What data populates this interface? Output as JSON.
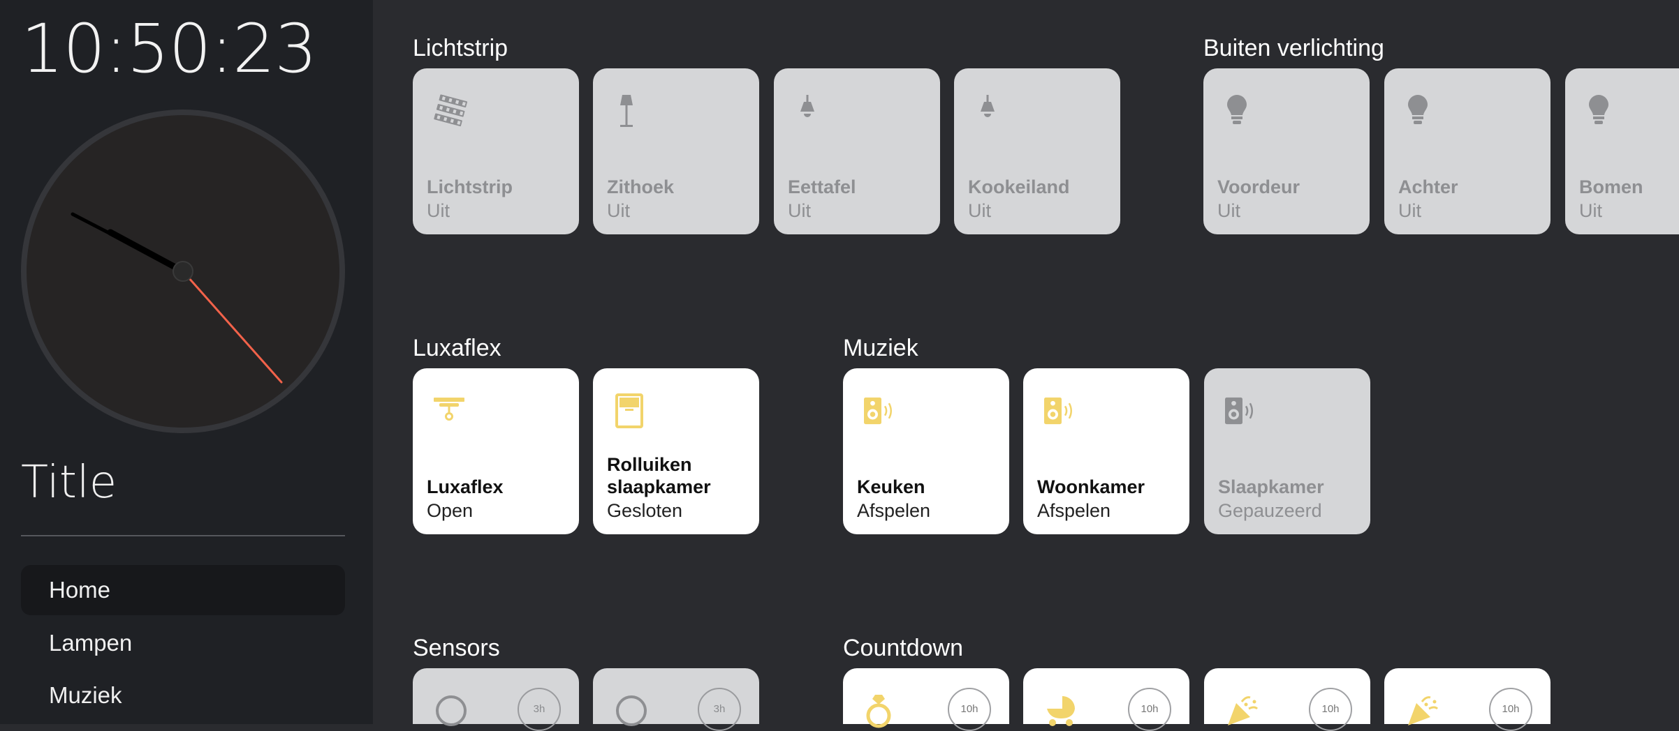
{
  "sidebar": {
    "clock": "10:50:23",
    "title": "Title",
    "nav": [
      {
        "label": "Home",
        "active": true
      },
      {
        "label": "Lampen",
        "active": false
      },
      {
        "label": "Muziek",
        "active": false
      }
    ]
  },
  "sections": {
    "lichtstrip": {
      "title": "Lichtstrip",
      "tiles": [
        {
          "name": "Lichtstrip",
          "state": "Uit",
          "icon": "led-strip-icon"
        },
        {
          "name": "Zithoek",
          "state": "Uit",
          "icon": "floor-lamp-icon"
        },
        {
          "name": "Eettafel",
          "state": "Uit",
          "icon": "ceiling-light-icon"
        },
        {
          "name": "Kookeiland",
          "state": "Uit",
          "icon": "ceiling-light-icon"
        }
      ]
    },
    "buiten": {
      "title": "Buiten verlichting",
      "tiles": [
        {
          "name": "Voordeur",
          "state": "Uit",
          "icon": "bulb-icon"
        },
        {
          "name": "Achter",
          "state": "Uit",
          "icon": "bulb-icon"
        },
        {
          "name": "Bomen",
          "state": "Uit",
          "icon": "bulb-icon"
        }
      ]
    },
    "luxaflex": {
      "title": "Luxaflex",
      "tiles": [
        {
          "name": "Luxaflex",
          "state": "Open",
          "icon": "blinds-open-icon"
        },
        {
          "name": "Rolluiken slaapkamer",
          "state": "Gesloten",
          "icon": "shutter-closed-icon"
        }
      ]
    },
    "muziek": {
      "title": "Muziek",
      "tiles": [
        {
          "name": "Keuken",
          "state": "Afspelen",
          "icon": "speaker-icon"
        },
        {
          "name": "Woonkamer",
          "state": "Afspelen",
          "icon": "speaker-icon"
        },
        {
          "name": "Slaapkamer",
          "state": "Gepauzeerd",
          "icon": "speaker-icon"
        }
      ]
    },
    "sensors": {
      "title": "Sensors",
      "tiles": [
        {
          "timer": "3h",
          "icon": "circle-outline-icon"
        },
        {
          "timer": "3h",
          "icon": "circle-outline-icon"
        }
      ]
    },
    "countdown": {
      "title": "Countdown",
      "tiles": [
        {
          "timer": "10h",
          "icon": "ring-icon"
        },
        {
          "timer": "10h",
          "icon": "baby-carriage-icon"
        },
        {
          "timer": "10h",
          "icon": "party-popper-icon"
        },
        {
          "timer": "10h",
          "icon": "party-popper-icon"
        }
      ]
    }
  },
  "colors": {
    "accent": "#f2d46b",
    "inactive_icon": "#8e8f92",
    "second_hand": "#f2624a"
  }
}
